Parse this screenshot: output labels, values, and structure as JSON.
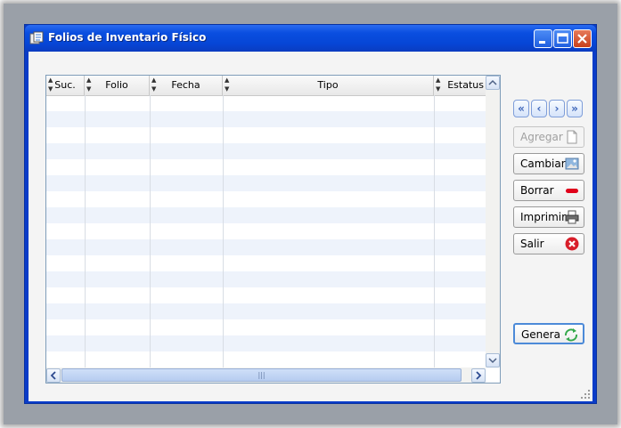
{
  "window": {
    "title": "Folios de Inventario Físico"
  },
  "table": {
    "columns": [
      {
        "label": "Suc."
      },
      {
        "label": "Folio"
      },
      {
        "label": "Fecha"
      },
      {
        "label": "Tipo"
      },
      {
        "label": "Estatus"
      }
    ],
    "row_count": 17,
    "hscroll_grip": "|||"
  },
  "nav": {
    "first": "«",
    "prev": "‹",
    "next": "›",
    "last": "»"
  },
  "buttons": {
    "agregar": "Agregar",
    "cambiar": "Cambiar",
    "borrar": "Borrar",
    "imprimir": "Imprimir",
    "salir": "Salir",
    "genera": "Genera"
  },
  "colors": {
    "titlebar": "#0a4ee0",
    "borrar_icon": "#e0001a",
    "salir_icon": "#d81e2a",
    "genera_icon": "#33a84a"
  }
}
